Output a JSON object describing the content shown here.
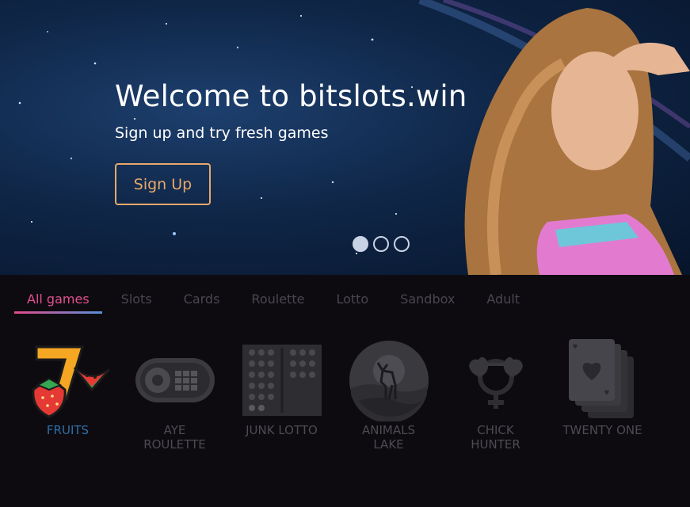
{
  "hero": {
    "title": "Welcome to bitslots.win",
    "subtitle": "Sign up and try fresh games",
    "signup_label": "Sign Up",
    "slides": 3,
    "active_slide": 1
  },
  "tabs": [
    {
      "label": "All games",
      "active": true
    },
    {
      "label": "Slots"
    },
    {
      "label": "Cards"
    },
    {
      "label": "Roulette"
    },
    {
      "label": "Lotto"
    },
    {
      "label": "Sandbox"
    },
    {
      "label": "Adult"
    }
  ],
  "games": [
    {
      "label": "FRUITS",
      "icon": "fruits-icon",
      "active": true
    },
    {
      "label": "AYE ROULETTE",
      "icon": "roulette-icon"
    },
    {
      "label": "JUNK LOTTO",
      "icon": "lotto-icon"
    },
    {
      "label": "ANIMALS LAKE",
      "icon": "deer-icon"
    },
    {
      "label": "CHICK HUNTER",
      "icon": "glasses-icon"
    },
    {
      "label": "TWENTY ONE",
      "icon": "cards-icon"
    }
  ],
  "colors": {
    "accent": "#e8a86a",
    "tab_active": "#e0508f",
    "game_active": "#2d6fa8",
    "inactive": "#4d4b52",
    "background": "#0e0b10"
  }
}
